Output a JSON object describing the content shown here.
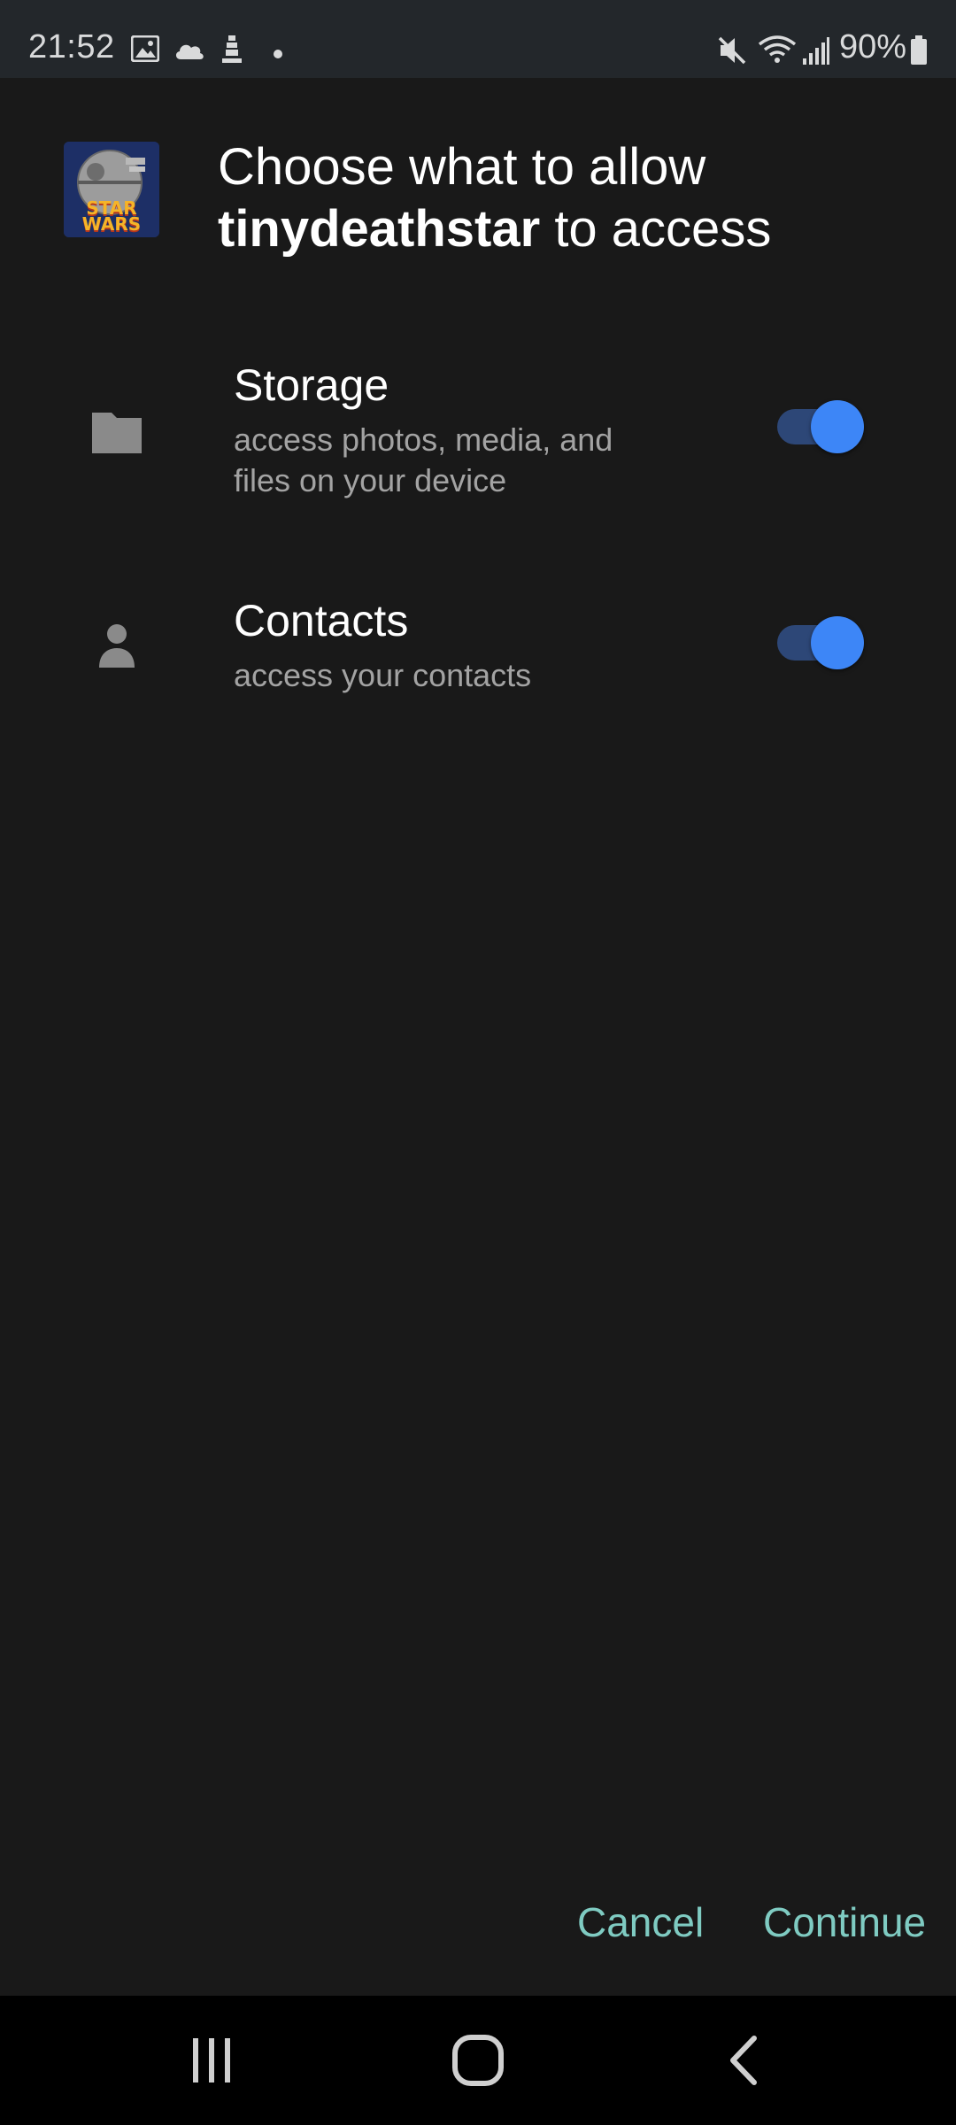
{
  "status_bar": {
    "time": "21:52",
    "battery": "90%",
    "icons": [
      "gallery-icon",
      "cloud-icon",
      "tower-icon",
      "dot-icon",
      "mute-icon",
      "wifi-icon",
      "signal-icon",
      "battery-icon"
    ]
  },
  "dialog": {
    "app_name": "tinydeathstar",
    "title_line1": "Choose what to allow",
    "title_line2_suffix": " to access",
    "app_icon_text": "STAR WARS"
  },
  "permissions": [
    {
      "icon": "folder-icon",
      "title": "Storage",
      "description": "access photos, media, and files on your device",
      "enabled": true
    },
    {
      "icon": "person-icon",
      "title": "Contacts",
      "description": "access your contacts",
      "enabled": true
    }
  ],
  "actions": {
    "cancel_label": "Cancel",
    "continue_label": "Continue"
  },
  "nav": {
    "buttons": [
      "recents-icon",
      "home-icon",
      "back-icon"
    ]
  },
  "colors": {
    "background": "#191919",
    "accent_text": "#7fcbc2",
    "toggle_on": "#3d86f7"
  }
}
